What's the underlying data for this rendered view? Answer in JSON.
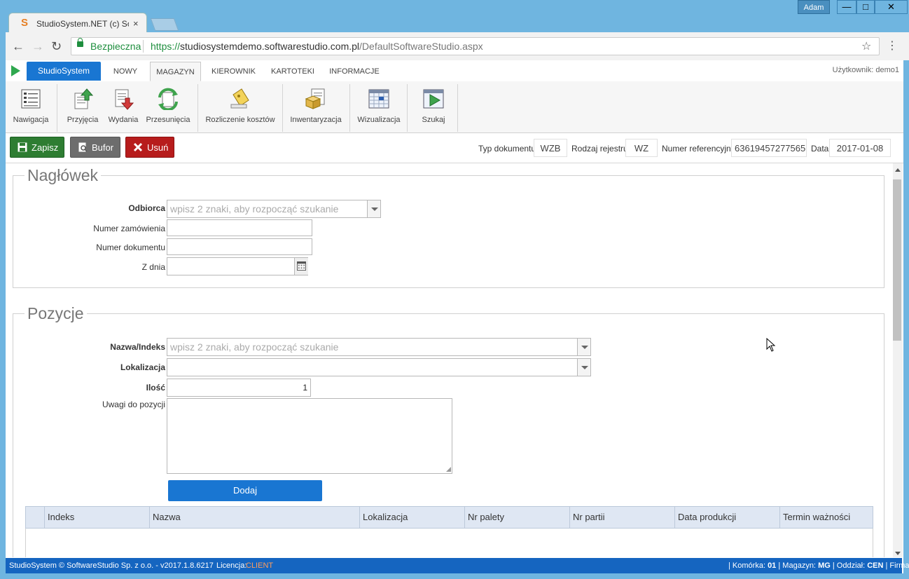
{
  "window": {
    "user": "Adam",
    "min_glyph": "—",
    "max_glyph": "□",
    "close_glyph": "✕"
  },
  "browser": {
    "tab_title": "StudioSystem.NET (c) Sof",
    "tab_close": "×",
    "back": "←",
    "forward": "→",
    "reload": "↻",
    "secure_label": "Bezpieczna",
    "url_scheme": "https://",
    "url_host": "studiosystemdemo.softwarestudio.com.pl",
    "url_path": "/DefaultSoftwareStudio.aspx",
    "star": "☆",
    "menu": "⋮"
  },
  "app": {
    "brand": "StudioSystem",
    "tabs": [
      "NOWY",
      "MAGAZYN",
      "KIEROWNIK",
      "KARTOTEKI",
      "INFORMACJE"
    ],
    "active_tab": "MAGAZYN",
    "user_label": "Użytkownik: demo1"
  },
  "ribbon": {
    "buttons": [
      {
        "label": "Nawigacja",
        "icon": "navigation-icon"
      },
      {
        "label": "Przyjęcia",
        "icon": "receipt-icon"
      },
      {
        "label": "Wydania",
        "icon": "issue-icon"
      },
      {
        "label": "Przesunięcia",
        "icon": "transfer-icon"
      },
      {
        "label": "Rozliczenie kosztów",
        "icon": "cost-settlement-icon"
      },
      {
        "label": "Inwentaryzacja",
        "icon": "inventory-icon"
      },
      {
        "label": "Wizualizacja",
        "icon": "visualization-icon"
      },
      {
        "label": "Szukaj",
        "icon": "search-icon"
      }
    ]
  },
  "actions": {
    "save": "Zapisz",
    "buffer": "Bufor",
    "delete": "Usuń",
    "doc_type_label": "Typ dokumentu",
    "doc_type_value": "WZB",
    "register_label": "Rodzaj rejestru",
    "register_value": "WZ",
    "ref_label": "Numer referencyjny",
    "ref_value": "63619457277565",
    "date_label": "Data",
    "date_value": "2017-01-08"
  },
  "header_section": {
    "legend": "Nagłówek",
    "recipient_label": "Odbiorca",
    "recipient_placeholder": "wpisz 2 znaki, aby rozpocząć szukanie",
    "order_no_label": "Numer zamówienia",
    "order_no_value": "",
    "doc_no_label": "Numer dokumentu",
    "doc_no_value": "",
    "date_label": "Z dnia",
    "date_value": ""
  },
  "positions_section": {
    "legend": "Pozycje",
    "name_label": "Nazwa/Indeks",
    "name_placeholder": "wpisz 2 znaki, aby rozpocząć szukanie",
    "location_label": "Lokalizacja",
    "location_value": "",
    "qty_label": "Ilość",
    "qty_value": "1",
    "notes_label": "Uwagi do pozycji",
    "notes_value": "",
    "add_button": "Dodaj"
  },
  "grid": {
    "columns": [
      "",
      "Indeks",
      "Nazwa",
      "Lokalizacja",
      "Nr palety",
      "Nr partii",
      "Data produkcji",
      "Termin ważności"
    ],
    "rows": []
  },
  "status": {
    "copyright": "StudioSystem © SoftwareStudio Sp. z o.o. - v2017.1.8.6217",
    "license_label": "Licencja:",
    "license_value": "CLIENT",
    "cell_label": "Komórka:",
    "cell_value": "01",
    "warehouse_label": "Magazyn:",
    "warehouse_value": "MG",
    "branch_label": "Oddział:",
    "branch_value": "CEN",
    "company_label": "Firma:"
  },
  "colors": {
    "brand_blue": "#1976d2",
    "save_green": "#2e7d32",
    "delete_red": "#b71c1c",
    "status_blue": "#1565c0",
    "license_orange": "#ff9d5c"
  }
}
